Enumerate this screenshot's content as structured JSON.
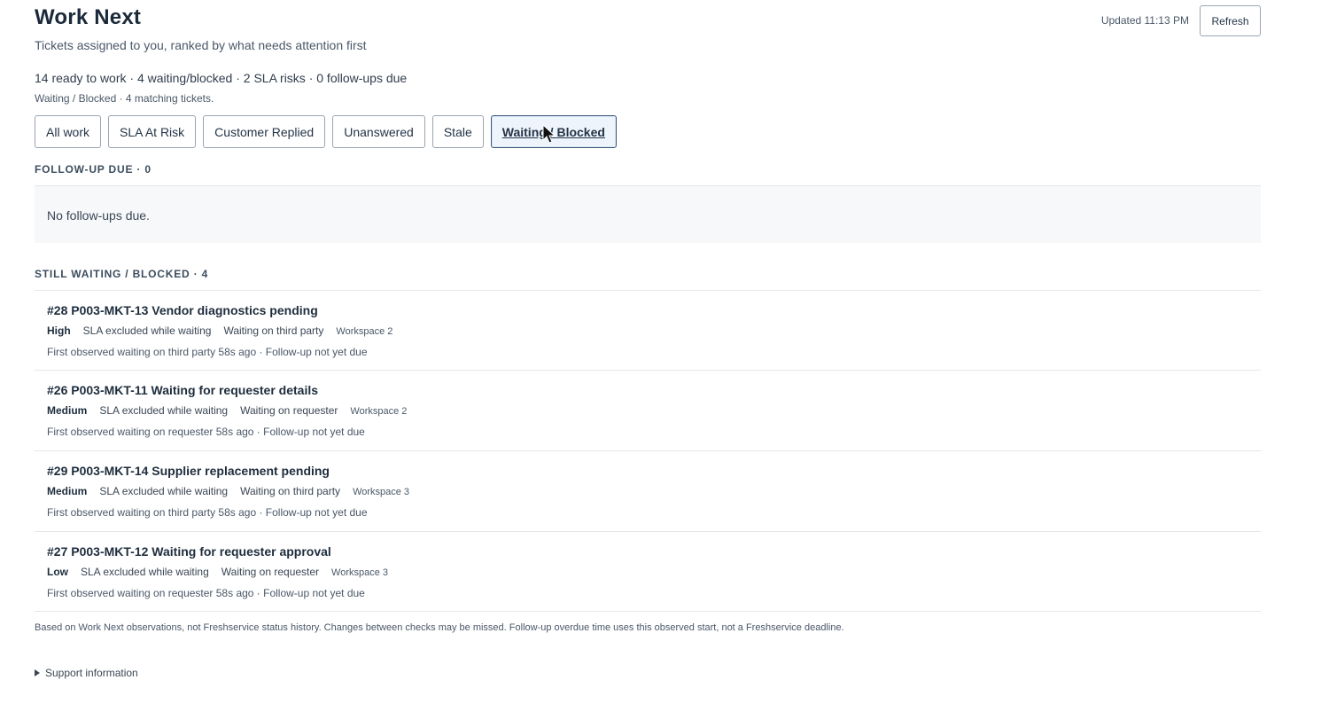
{
  "header": {
    "title": "Work Next",
    "subtitle": "Tickets assigned to you, ranked by what needs attention first",
    "updated": "Updated 11:13 PM",
    "refresh_label": "Refresh"
  },
  "summary": "14 ready to work · 4 waiting/blocked · 2 SLA risks · 0 follow-ups due",
  "filter_note": "Waiting / Blocked · 4 matching tickets.",
  "filters": [
    {
      "label": "All work"
    },
    {
      "label": "SLA At Risk"
    },
    {
      "label": "Customer Replied"
    },
    {
      "label": "Unanswered"
    },
    {
      "label": "Stale"
    },
    {
      "label": "Waiting / Blocked",
      "active": true
    }
  ],
  "followup": {
    "title": "FOLLOW-UP DUE · 0",
    "empty": "No follow-ups due."
  },
  "waiting": {
    "title": "STILL WAITING / BLOCKED · 4",
    "tickets": [
      {
        "title": "#28 P003-MKT-13 Vendor diagnostics pending",
        "priority": "High",
        "sla": "SLA excluded while waiting",
        "status": "Waiting on third party",
        "workspace": "Workspace 2",
        "observed": "First observed waiting on third party 58s ago · Follow-up not yet due"
      },
      {
        "title": "#26 P003-MKT-11 Waiting for requester details",
        "priority": "Medium",
        "sla": "SLA excluded while waiting",
        "status": "Waiting on requester",
        "workspace": "Workspace 2",
        "observed": "First observed waiting on requester 58s ago · Follow-up not yet due"
      },
      {
        "title": "#29 P003-MKT-14 Supplier replacement pending",
        "priority": "Medium",
        "sla": "SLA excluded while waiting",
        "status": "Waiting on third party",
        "workspace": "Workspace 3",
        "observed": "First observed waiting on third party 58s ago · Follow-up not yet due"
      },
      {
        "title": "#27 P003-MKT-12 Waiting for requester approval",
        "priority": "Low",
        "sla": "SLA excluded while waiting",
        "status": "Waiting on requester",
        "workspace": "Workspace 3",
        "observed": "First observed waiting on requester 58s ago · Follow-up not yet due"
      }
    ]
  },
  "footnote": "Based on Work Next observations, not Freshservice status history. Changes between checks may be missed. Follow-up overdue time uses this observed start, not a Freshservice deadline.",
  "support_label": "Support information",
  "icons": {
    "support": "disclosure-triangle-icon",
    "cursor": "mouse-pointer-icon"
  }
}
